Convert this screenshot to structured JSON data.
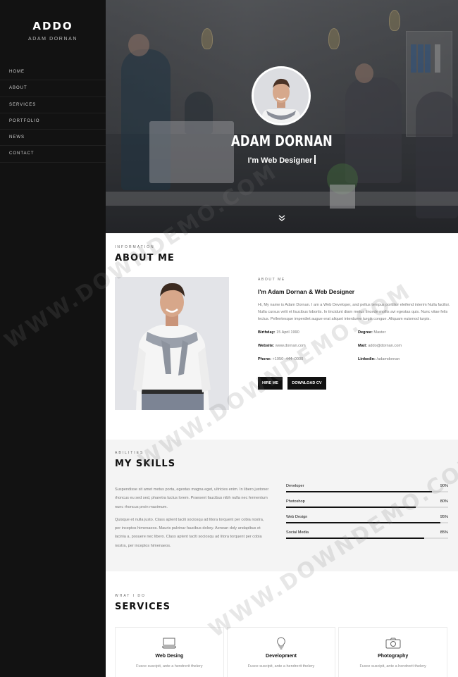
{
  "sidebar": {
    "brand_title": "ADDO",
    "brand_subtitle": "ADAM DORNAN",
    "nav": [
      "HOME",
      "ABOUT",
      "SERVICES",
      "PORTFOLIO",
      "NEWS",
      "CONTACT"
    ]
  },
  "hero": {
    "name": "ADAM DORNAN",
    "role": "I'm Web Designer",
    "scroll_icon": "double-chevron-down-icon"
  },
  "about": {
    "kicker": "INFORMATION",
    "title": "ABOUT ME",
    "label": "ABOUT ME",
    "intro": "I'm Adam Dornan & Web Designer",
    "bio": "Hi, My name is Adam Dornan. I am a Web Developer, and pellus tempus porttitor eleifend interim Nulla facilisi. Nulla cursus velit et faucibus lobortis. In tincidunt diam metus tincede mollis avi egestas quis. Nunc vitae felis lectus. Pellentesque imperdiet augue erat aliquet interdume turgis congue. Aliquam euismod turpis.",
    "facts": [
      {
        "label": "Birthday:",
        "value": "15 April 1990"
      },
      {
        "label": "Degree:",
        "value": "Master"
      },
      {
        "label": "Website:",
        "value": "www.dornan.com"
      },
      {
        "label": "Mail:",
        "value": "addo@dornan.com"
      },
      {
        "label": "Phone:",
        "value": "+1950–444–0000"
      },
      {
        "label": "Linkedin:",
        "value": "/adamdornan"
      }
    ],
    "buttons": {
      "hire": "HIRE ME",
      "download": "DOWNLOAD CV"
    }
  },
  "skills": {
    "kicker": "ABILITIES",
    "title": "MY SKILLS",
    "paragraphs": [
      "Suspendisse sit amet metus porta, egestas magna eget, ultricies enim. In libero justoner rhoncus eu sed sed, pharetra luctus lorem. Praesent faucibus nibh nulla nec fermentum nunc rhoncus proin maximum.",
      "Quisque et nulla justo. Class aptent taciti sociosqu ad litora torquent per cobia nostra, per inceptos himenaeos. Mauris pulvinar faucibus dolory. Aenean doly andapibus et lacinia a, posuere nec libero. Class aptent taciti sociosqu ad litora torquent per cobia nostra, per inceptos himenaeos."
    ],
    "items": [
      {
        "name": "Developer",
        "percent_label": "90%",
        "value": 90
      },
      {
        "name": "Photoshop",
        "percent_label": "80%",
        "value": 80
      },
      {
        "name": "Web Design",
        "percent_label": "95%",
        "value": 95
      },
      {
        "name": "Social Media",
        "percent_label": "85%",
        "value": 85
      }
    ]
  },
  "services": {
    "kicker": "WHAT I DO",
    "title": "SERVICES",
    "cards": [
      {
        "title": "Web Desing",
        "text": "Fusce suscipit, ante a hendrerit thelery",
        "icon": "monitor-icon"
      },
      {
        "title": "Development",
        "text": "Fusce suscipit, ante a hendrerit thelery",
        "icon": "lightbulb-icon"
      },
      {
        "title": "Photography",
        "text": "Fusce suscipit, ante a hendrerit thelery",
        "icon": "camera-icon"
      }
    ]
  },
  "watermark": "WWW.DOWNDEMO.COM"
}
